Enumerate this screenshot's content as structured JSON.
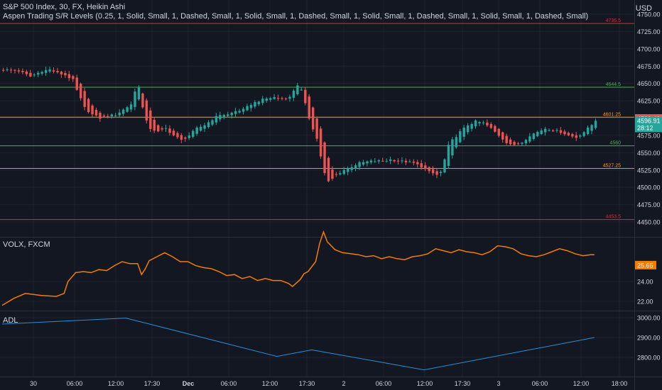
{
  "header": {
    "symbol_line": "S&P 500 Index, 30, FX, Heikin Ashi",
    "indicator_line": "Aspen Trading S/R Levels (0.25, 1, Solid, Small, 1, Dashed, Small, 1, Solid, Small, 1, Dashed, Small, 1, Solid, Small, 1, Dashed, Small, 1, Solid, Small, 1, Dashed, Small)",
    "currency": "USD"
  },
  "panes": {
    "volx_title": "VOLX, FXCM",
    "adl_title": "ADL"
  },
  "colors": {
    "background": "#131722",
    "grid": "#1e222d",
    "up": "#26a69a",
    "down": "#ef5350",
    "text": "#d1d4dc",
    "volx_line": "#f57c00",
    "adl_line": "#2a8fd8",
    "sr_red": "#d32f2f",
    "sr_green": "#4caf50",
    "sr_orange": "#ff9800"
  },
  "chart_data": [
    {
      "type": "candlestick",
      "title": "S&P 500 Index, 30, FX, Heikin Ashi",
      "ylim": [
        4438,
        4758
      ],
      "y_ticks": [
        "4750.00",
        "4725.00",
        "4700.00",
        "4675.00",
        "4650.00",
        "4625.00",
        "4600.00",
        "4575.00",
        "4550.00",
        "4525.00",
        "4500.00",
        "4475.00",
        "4450.00"
      ],
      "x_ticks": [
        "30",
        "06:00",
        "12:00",
        "17:30",
        "Dec",
        "06:00",
        "12:00",
        "17:30",
        "2",
        "06:00",
        "12:00",
        "17:30",
        "3",
        "06:00",
        "12:00",
        "18:00"
      ],
      "levels": [
        {
          "label": "4736.5",
          "value": 4736.5,
          "color": "#d32f2f"
        },
        {
          "label": "4644.5",
          "value": 4644.5,
          "color": "#4caf50"
        },
        {
          "label": "4601.25",
          "value": 4601.25,
          "color": "#ff9800"
        },
        {
          "label": "4560",
          "value": 4560,
          "color": "#4caf50"
        },
        {
          "label": "4527.25",
          "value": 4527.25,
          "color": "#ff9800"
        },
        {
          "label": "4453.5",
          "value": 4453.5,
          "color": "#d32f2f"
        }
      ],
      "last_price": {
        "label": "4599.43",
        "value": 4599.43
      },
      "current_price": {
        "label": "4596.91",
        "value": 4596.91
      },
      "countdown": "28:12",
      "close_path": [
        [
          0,
          4670
        ],
        [
          4,
          4668
        ],
        [
          7,
          4660
        ],
        [
          10,
          4668
        ],
        [
          12,
          4670
        ],
        [
          14,
          4665
        ],
        [
          16,
          4662
        ],
        [
          18,
          4655
        ],
        [
          19,
          4640
        ],
        [
          21,
          4615
        ],
        [
          23,
          4605
        ],
        [
          25,
          4600
        ],
        [
          27,
          4603
        ],
        [
          29,
          4605
        ],
        [
          31,
          4612
        ],
        [
          33,
          4620
        ],
        [
          34,
          4638
        ],
        [
          35,
          4645
        ],
        [
          36,
          4615
        ],
        [
          37,
          4595
        ],
        [
          38,
          4585
        ],
        [
          40,
          4580
        ],
        [
          42,
          4585
        ],
        [
          44,
          4575
        ],
        [
          46,
          4568
        ],
        [
          48,
          4575
        ],
        [
          50,
          4585
        ],
        [
          52,
          4590
        ],
        [
          54,
          4598
        ],
        [
          56,
          4605
        ],
        [
          58,
          4605
        ],
        [
          60,
          4610
        ],
        [
          62,
          4612
        ],
        [
          64,
          4620
        ],
        [
          66,
          4625
        ],
        [
          68,
          4628
        ],
        [
          70,
          4630
        ],
        [
          72,
          4628
        ],
        [
          74,
          4630
        ],
        [
          75,
          4640
        ],
        [
          76,
          4648
        ],
        [
          77,
          4640
        ],
        [
          78,
          4620
        ],
        [
          79,
          4600
        ],
        [
          80,
          4585
        ],
        [
          81,
          4570
        ],
        [
          82,
          4545
        ],
        [
          83,
          4520
        ],
        [
          84,
          4508
        ],
        [
          85,
          4512
        ],
        [
          86,
          4518
        ],
        [
          88,
          4525
        ],
        [
          90,
          4530
        ],
        [
          92,
          4535
        ],
        [
          94,
          4537
        ],
        [
          96,
          4538
        ],
        [
          98,
          4538
        ],
        [
          100,
          4540
        ],
        [
          102,
          4538
        ],
        [
          104,
          4537
        ],
        [
          106,
          4535
        ],
        [
          108,
          4530
        ],
        [
          110,
          4522
        ],
        [
          112,
          4518
        ],
        [
          113,
          4522
        ],
        [
          114,
          4540
        ],
        [
          115,
          4560
        ],
        [
          116,
          4568
        ],
        [
          118,
          4580
        ],
        [
          120,
          4590
        ],
        [
          122,
          4595
        ],
        [
          124,
          4593
        ],
        [
          126,
          4585
        ],
        [
          128,
          4575
        ],
        [
          130,
          4565
        ],
        [
          132,
          4560
        ],
        [
          134,
          4565
        ],
        [
          136,
          4575
        ],
        [
          138,
          4580
        ],
        [
          140,
          4585
        ],
        [
          142,
          4583
        ],
        [
          144,
          4580
        ],
        [
          146,
          4575
        ],
        [
          148,
          4572
        ],
        [
          150,
          4580
        ],
        [
          152,
          4590
        ],
        [
          153,
          4596.91
        ]
      ]
    },
    {
      "type": "line",
      "title": "VOLX, FXCM",
      "ylim": [
        19.5,
        30
      ],
      "y_ticks": [
        "24.00",
        "22.00"
      ],
      "last_value_label": "25.65",
      "last_value": 25.65,
      "points": [
        [
          0,
          21.6
        ],
        [
          3,
          22.3
        ],
        [
          6,
          22.8
        ],
        [
          10,
          22.6
        ],
        [
          14,
          22.5
        ],
        [
          16,
          22.8
        ],
        [
          17,
          24.0
        ],
        [
          19,
          24.9
        ],
        [
          21,
          25.0
        ],
        [
          23,
          24.9
        ],
        [
          25,
          25.2
        ],
        [
          27,
          25.1
        ],
        [
          29,
          25.6
        ],
        [
          31,
          26.0
        ],
        [
          33,
          25.8
        ],
        [
          35,
          25.8
        ],
        [
          36,
          24.7
        ],
        [
          37,
          25.3
        ],
        [
          38,
          26.1
        ],
        [
          40,
          26.5
        ],
        [
          42,
          26.9
        ],
        [
          44,
          26.5
        ],
        [
          46,
          26.0
        ],
        [
          48,
          26.0
        ],
        [
          50,
          25.6
        ],
        [
          52,
          25.4
        ],
        [
          54,
          25.3
        ],
        [
          56,
          25.0
        ],
        [
          58,
          24.6
        ],
        [
          60,
          24.7
        ],
        [
          62,
          24.3
        ],
        [
          64,
          24.5
        ],
        [
          66,
          24.1
        ],
        [
          68,
          24.3
        ],
        [
          70,
          24.1
        ],
        [
          72,
          24.1
        ],
        [
          74,
          23.8
        ],
        [
          75,
          23.5
        ],
        [
          77,
          24.2
        ],
        [
          78,
          24.8
        ],
        [
          79,
          25.0
        ],
        [
          80,
          25.5
        ],
        [
          81,
          26.0
        ],
        [
          82,
          27.8
        ],
        [
          83,
          29.0
        ],
        [
          84,
          28.0
        ],
        [
          86,
          27.2
        ],
        [
          88,
          26.9
        ],
        [
          90,
          26.8
        ],
        [
          92,
          26.7
        ],
        [
          94,
          26.5
        ],
        [
          96,
          26.6
        ],
        [
          98,
          26.3
        ],
        [
          100,
          26.5
        ],
        [
          102,
          26.3
        ],
        [
          104,
          26.2
        ],
        [
          106,
          26.5
        ],
        [
          108,
          26.6
        ],
        [
          110,
          26.8
        ],
        [
          112,
          27.3
        ],
        [
          114,
          27.1
        ],
        [
          116,
          26.9
        ],
        [
          118,
          27.2
        ],
        [
          120,
          27.0
        ],
        [
          122,
          26.9
        ],
        [
          124,
          26.7
        ],
        [
          126,
          27.0
        ],
        [
          128,
          27.6
        ],
        [
          130,
          27.5
        ],
        [
          132,
          27.3
        ],
        [
          134,
          26.8
        ],
        [
          136,
          26.6
        ],
        [
          138,
          26.5
        ],
        [
          140,
          26.7
        ],
        [
          142,
          27.0
        ],
        [
          144,
          27.3
        ],
        [
          146,
          27.1
        ],
        [
          148,
          26.8
        ],
        [
          150,
          26.6
        ],
        [
          152,
          26.7
        ],
        [
          153,
          26.7
        ]
      ]
    },
    {
      "type": "line",
      "title": "ADL",
      "ylim": [
        2755,
        3015
      ],
      "y_ticks": [
        "3000.00",
        "2900.00",
        "2800.00"
      ],
      "points": [
        [
          0,
          2968
        ],
        [
          32,
          2998
        ],
        [
          71,
          2805
        ],
        [
          80,
          2838
        ],
        [
          109,
          2737
        ],
        [
          153,
          2900
        ]
      ]
    }
  ]
}
